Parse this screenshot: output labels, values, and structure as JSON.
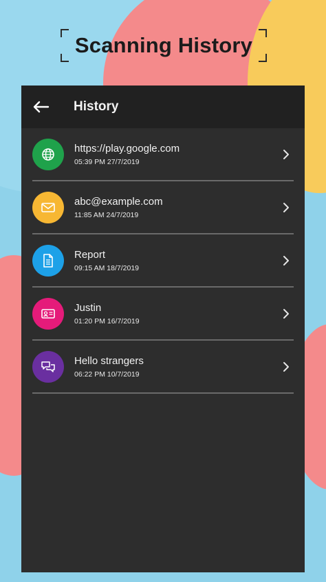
{
  "promo": {
    "title": "Scanning History"
  },
  "appbar": {
    "title": "History",
    "back_icon": "arrow-left-icon"
  },
  "history": [
    {
      "title": "https://play.google.com",
      "timestamp": "05:39 PM 27/7/2019",
      "icon": "globe-icon",
      "color": "#1fa24b"
    },
    {
      "title": "abc@example.com",
      "timestamp": "11:85 AM 24/7/2019",
      "icon": "mail-icon",
      "color": "#f7b733"
    },
    {
      "title": "Report",
      "timestamp": "09:15 AM 18/7/2019",
      "icon": "document-icon",
      "color": "#1da1e8"
    },
    {
      "title": "Justin",
      "timestamp": "01:20 PM 16/7/2019",
      "icon": "contact-card-icon",
      "color": "#e51b7a"
    },
    {
      "title": "Hello strangers",
      "timestamp": "06:22 PM 10/7/2019",
      "icon": "chat-icon",
      "color": "#6a2fa0"
    }
  ]
}
